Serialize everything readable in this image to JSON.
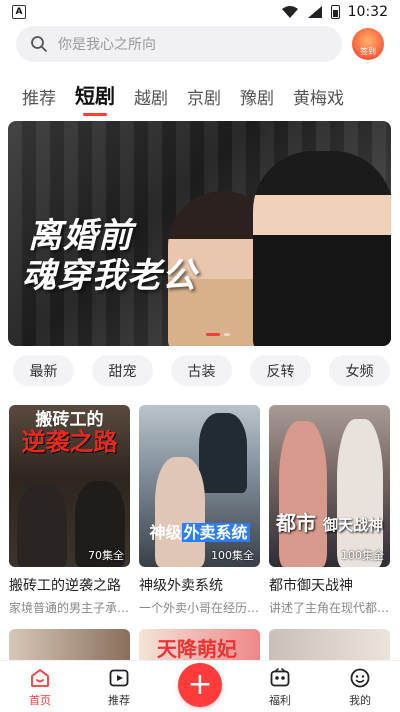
{
  "status_bar": {
    "time": "10:32",
    "notification_icon": "A"
  },
  "search": {
    "placeholder": "你是我心之所向"
  },
  "checkin": {
    "label": "签到"
  },
  "tabs": [
    {
      "label": "推荐"
    },
    {
      "label": "短剧"
    },
    {
      "label": "越剧"
    },
    {
      "label": "京剧"
    },
    {
      "label": "豫剧"
    },
    {
      "label": "黄梅戏"
    }
  ],
  "banner": {
    "title_line1": "离婚前",
    "title_line2": "魂穿我老公"
  },
  "chips": [
    "最新",
    "甜宠",
    "古装",
    "反转",
    "女频"
  ],
  "dramas": [
    {
      "title": "搬砖工的逆袭之路",
      "desc": "家境普通的男主子承父业...",
      "episodes": "70集全",
      "poster_text_1": "搬砖工的",
      "poster_text_2": "逆袭之路"
    },
    {
      "title": "神级外卖系统",
      "desc": "一个外卖小哥在经历了...",
      "episodes": "100集全",
      "poster_text_1": "神级",
      "poster_text_2": "外卖系统"
    },
    {
      "title": "都市御天战神",
      "desc": "讲述了主角在现代都市...",
      "episodes": "100集全",
      "poster_text_1": "都市",
      "poster_text_2": "御天战神"
    }
  ],
  "row2": {
    "poster_text": "天降萌妃"
  },
  "bottom_nav": {
    "home": "首页",
    "recommend": "推荐",
    "welfare": "福利",
    "mine": "我的"
  },
  "colors": {
    "accent": "#ff3b3b"
  }
}
